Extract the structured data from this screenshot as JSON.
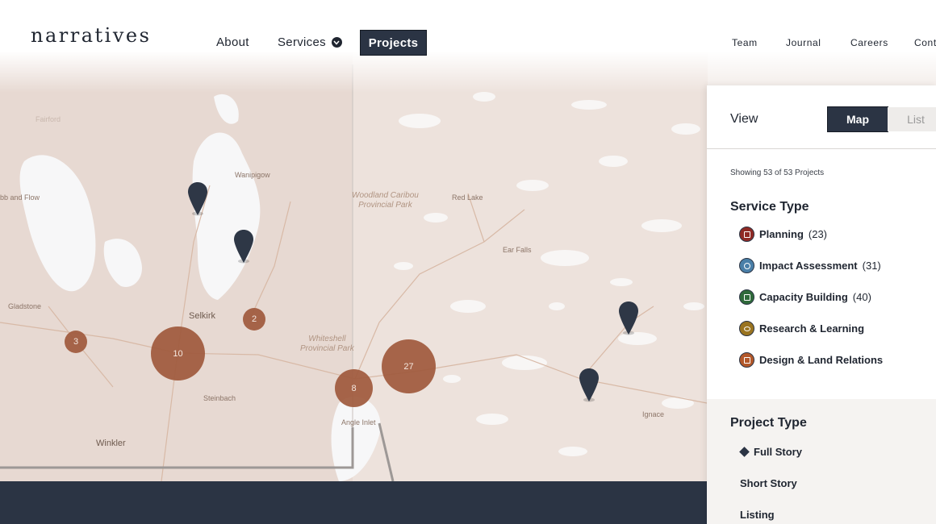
{
  "header": {
    "logo": "narratives",
    "nav": {
      "about": "About",
      "services": "Services",
      "projects": "Projects"
    },
    "nav_right": {
      "team": "Team",
      "journal": "Journal",
      "careers": "Careers",
      "contact": "Cont"
    }
  },
  "map": {
    "labels": {
      "fairford": "Fairford",
      "wanipigow": "Wanipigow",
      "bb_and_flow": "bb and Flow",
      "woodland_caribou": "Woodland Caribou",
      "woodland_caribou_2": "Provincial Park",
      "red_lake": "Red Lake",
      "ear_falls": "Ear Falls",
      "gladstone": "Gladstone",
      "selkirk": "Selkirk",
      "whiteshell": "Whiteshell",
      "whiteshell_2": "Provincial Park",
      "steinbach": "Steinbach",
      "winkler": "Winkler",
      "angle_inlet": "Angle Inlet",
      "ignace": "Ignace"
    },
    "clusters": {
      "c3": "3",
      "c10": "10",
      "c2": "2",
      "c8": "8",
      "c27": "27"
    }
  },
  "panel": {
    "view_label": "View",
    "toggle_map": "Map",
    "toggle_list": "List",
    "showing": "Showing 53 of 53 Projects",
    "service_heading": "Service Type",
    "services": [
      {
        "label": "Planning",
        "count": "(23)",
        "color": "#8f2a25"
      },
      {
        "label": "Impact Assessment",
        "count": "(31)",
        "color": "#4a7fa8"
      },
      {
        "label": "Capacity Building",
        "count": "(40)",
        "color": "#2f6a3a"
      },
      {
        "label": "Research & Learning",
        "count": "",
        "color": "#9a7420"
      },
      {
        "label": "Design & Land Relations",
        "count": "",
        "color": "#b3582a"
      }
    ],
    "project_heading": "Project Type",
    "project_types": [
      "Full Story",
      "Short Story",
      "Listing"
    ]
  }
}
